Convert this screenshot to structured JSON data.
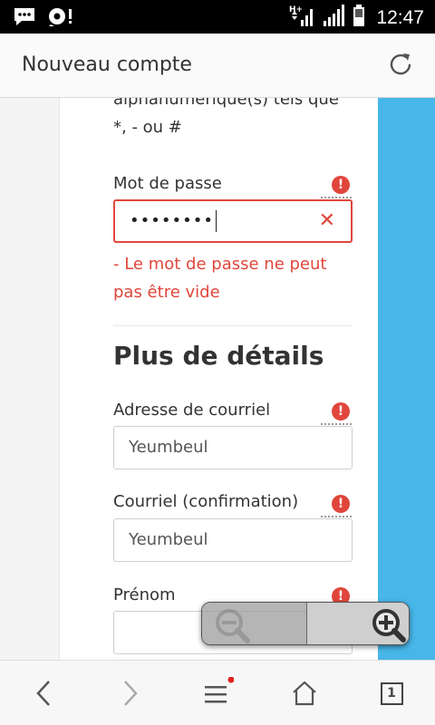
{
  "status_bar": {
    "time": "12:47",
    "icons": [
      "chat-notification-icon",
      "sync-notification-icon",
      "network-type-icon",
      "signal-icon",
      "signal-icon-2",
      "battery-icon"
    ],
    "network_type": "H+"
  },
  "app_bar": {
    "title": "Nouveau compte",
    "reload_icon": "reload-icon"
  },
  "form": {
    "helper_text": "alphanumérique(s) tels que *, - ou #",
    "password": {
      "label": "Mot de passe",
      "value": "••••••••",
      "error": "- Le mot de passe ne peut pas être vide"
    },
    "section_title": "Plus de détails",
    "email": {
      "label": "Adresse de courriel",
      "value": "Yeumbeul"
    },
    "email_confirm": {
      "label": "Courriel (confirmation)",
      "value": "Yeumbeul"
    },
    "first_name": {
      "label": "Prénom",
      "value": ""
    },
    "required_icon": "!"
  },
  "zoom": {
    "out_icon": "zoom-out-icon",
    "in_icon": "zoom-in-icon"
  },
  "bottom_nav": {
    "tab_count": "1"
  },
  "colors": {
    "error": "#e0463b",
    "accent_strip": "#47b6e8",
    "status_bar": "#000000"
  }
}
